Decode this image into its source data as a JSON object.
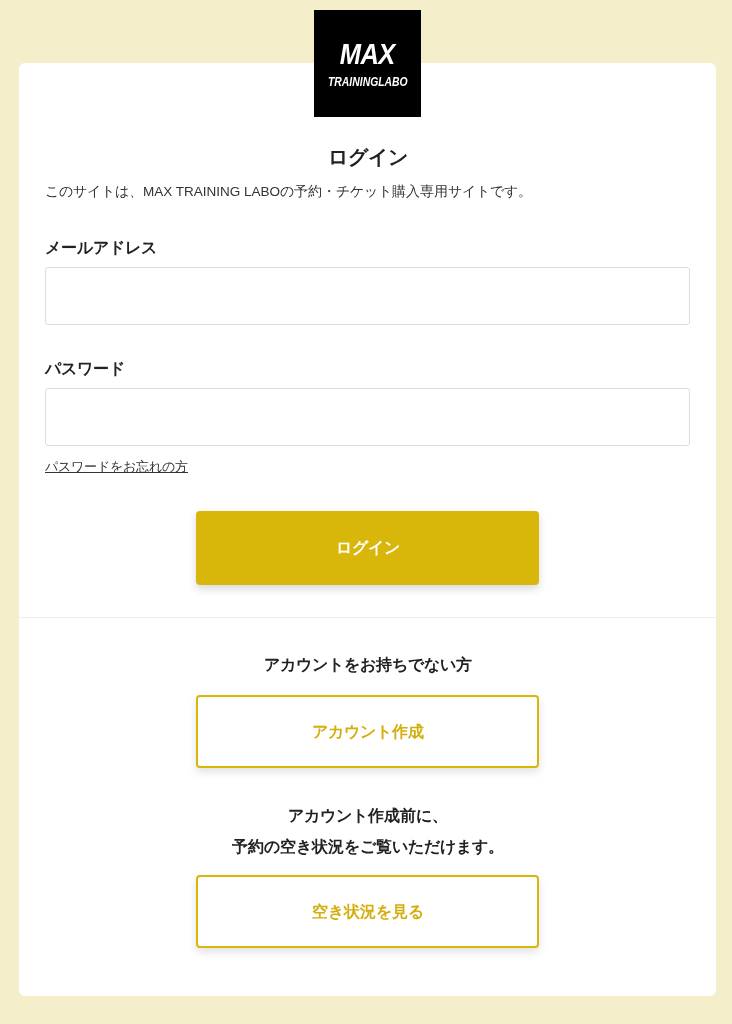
{
  "logo": {
    "line_1": "MAX",
    "line_2": "TRAININGLABO"
  },
  "login": {
    "title": "ログイン",
    "description": "このサイトは、MAX TRAINING LABOの予約・チケット購入専用サイトです。",
    "fields": [
      {
        "label": "メールアドレス"
      },
      {
        "label": "パスワード"
      }
    ],
    "forgot_password_link": "パスワードをお忘れの方",
    "submit_button": "ログイン"
  },
  "signup": {
    "heading": "アカウントをお持ちでない方",
    "button": "アカウント作成",
    "availability_note_lines": [
      "アカウント作成前に、",
      "予約の空き状況をご覧いただけます。"
    ],
    "availability_button": "空き状況を見る"
  }
}
